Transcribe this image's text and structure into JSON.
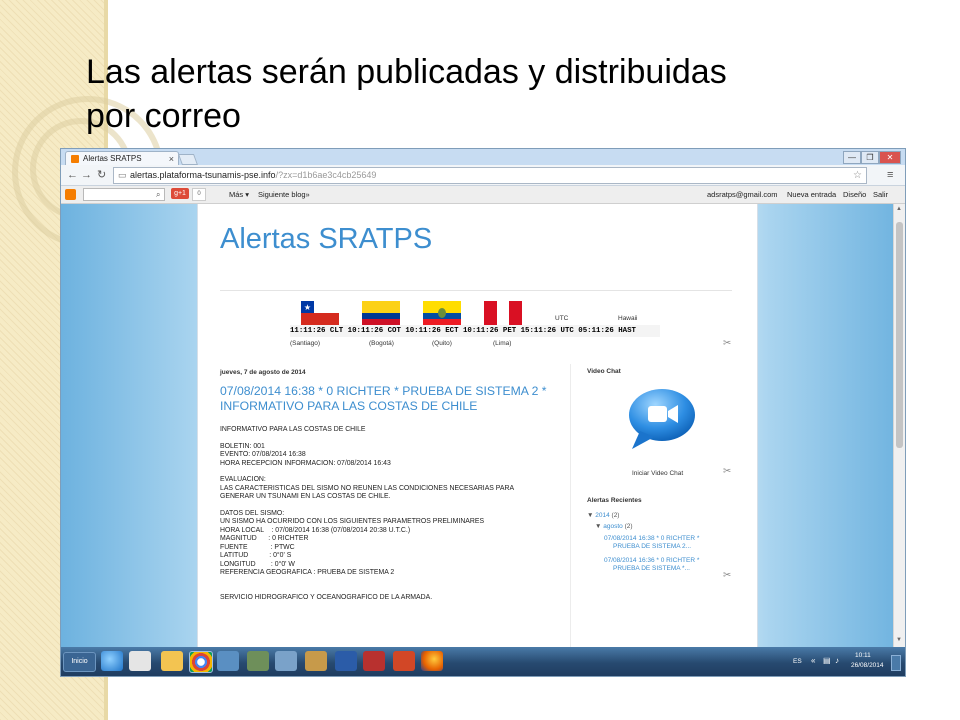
{
  "slide": {
    "title_line1": "Las alertas  serán publicadas y distribuidas",
    "title_line2": "por correo"
  },
  "browser": {
    "tab_title": "Alertas SRATPS",
    "tab_close": "×",
    "url_host": "alertas.plataforma-tsunamis-pse.info",
    "url_rest": "/?zx=d1b6ae3c4cb25649",
    "window_controls": [
      "—",
      "❐",
      "✕"
    ]
  },
  "blogger_navbar": {
    "gplus_label": "g+1",
    "gplus_count": "0",
    "more_label": "Más ▾",
    "next_blog": "Siguiente blog»",
    "user_email": "adsratps@gmail.com",
    "new_post": "Nueva entrada",
    "design": "Diseño",
    "sign_out": "Salir"
  },
  "blog": {
    "title": "Alertas SRATPS",
    "clock_text": "11:11:26 CLT 10:11:26 COT 10:11:26 ECT 10:11:26 PET 15:11:26 UTC 05:11:26 HAST",
    "clock_labels": [
      "UTC",
      "Hawaii"
    ],
    "cities": [
      "(Santiago)",
      "(Bogotá)",
      "(Quito)",
      "(Lima)"
    ],
    "post_date": "jueves, 7 de agosto de 2014",
    "post_title": "07/08/2014 16:38 * 0 RICHTER * PRUEBA DE SISTEMA 2 * INFORMATIVO PARA LAS COSTAS DE CHILE",
    "post_body": "INFORMATIVO PARA LAS COSTAS DE CHILE\n\nBOLETIN: 001\nEVENTO: 07/08/2014 16:38\nHORA RECEPCION INFORMACION: 07/08/2014 16:43\n\nEVALUACION:\nLAS CARACTERISTICAS DEL SISMO NO REUNEN LAS CONDICIONES NECESARIAS PARA\nGENERAR UN TSUNAMI EN LAS COSTAS DE CHILE.\n\nDATOS DEL SISMO:\nUN SISMO HA OCURRIDO CON LOS SIGUIENTES PARAMETROS PRELIMINARES\nHORA LOCAL    : 07/08/2014 16:38 (07/08/2014 20:38 U.T.C.)\nMAGNITUD      : 0 RICHTER\nFUENTE            : PTWC\nLATITUD           : 0°0' S\nLONGITUD        : 0°0' W\nREFERENCIA GEOGRAFICA : PRUEBA DE SISTEMA 2\n\n\nSERVICIO HIDROGRAFICO Y OCEANOGRAFICO DE LA ARMADA.",
    "sidebar": {
      "video_chat_heading": "Video Chat",
      "video_chat_link": "Iniciar Video Chat",
      "recent_heading": "Alertas Recientes",
      "year_label": "2014",
      "year_count": "(2)",
      "month_label": "agosto",
      "month_count": "(2)",
      "posts": [
        "07/08/2014 16:38 * 0 RICHTER *\n     PRUEBA DE SISTEMA 2...",
        "07/08/2014 16:36 * 0 RICHTER *\n     PRUEBA DE SISTEMA *..."
      ]
    }
  },
  "taskbar": {
    "start_label": "Inicio",
    "language": "ES",
    "time": "10:11",
    "date": "26/08/2014"
  },
  "colors": {
    "blog_blue": "#3d8ecf",
    "taskbar": "#2b4f74"
  }
}
